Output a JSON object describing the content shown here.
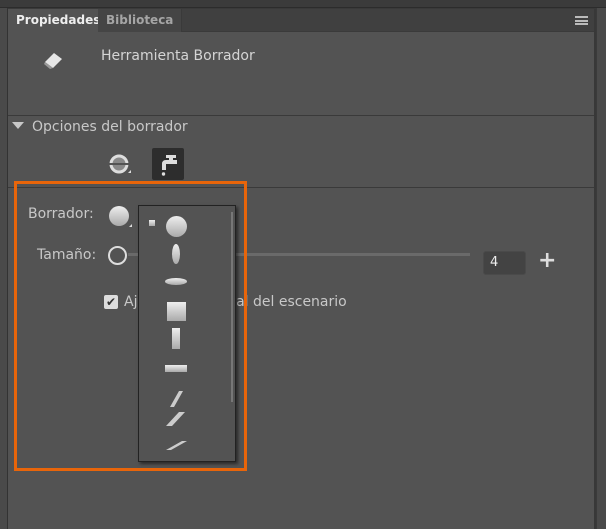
{
  "tabs": [
    {
      "label": "Propiedades",
      "active": true
    },
    {
      "label": "Biblioteca",
      "active": false
    }
  ],
  "tool": {
    "title": "Herramienta Borrador",
    "icon": "eraser-icon"
  },
  "section": {
    "title": "Opciones del borrador",
    "modes": [
      "eraser-mode-icon",
      "faucet-icon"
    ]
  },
  "eraser": {
    "label": "Borrador:"
  },
  "size": {
    "label": "Tamaño:",
    "value": "4",
    "plus": "+"
  },
  "checkbox": {
    "label": "Ajustar tamaño al del escenario",
    "checked": true
  },
  "shapes": [
    "small-square",
    "circle",
    "tall-ellipse",
    "wide-ellipse",
    "square",
    "tall-rectangle",
    "wide-rectangle",
    "slash-steep",
    "slash-medium",
    "slash-flat"
  ],
  "colors": {
    "highlight": "#e8650a",
    "panel": "#535353"
  }
}
